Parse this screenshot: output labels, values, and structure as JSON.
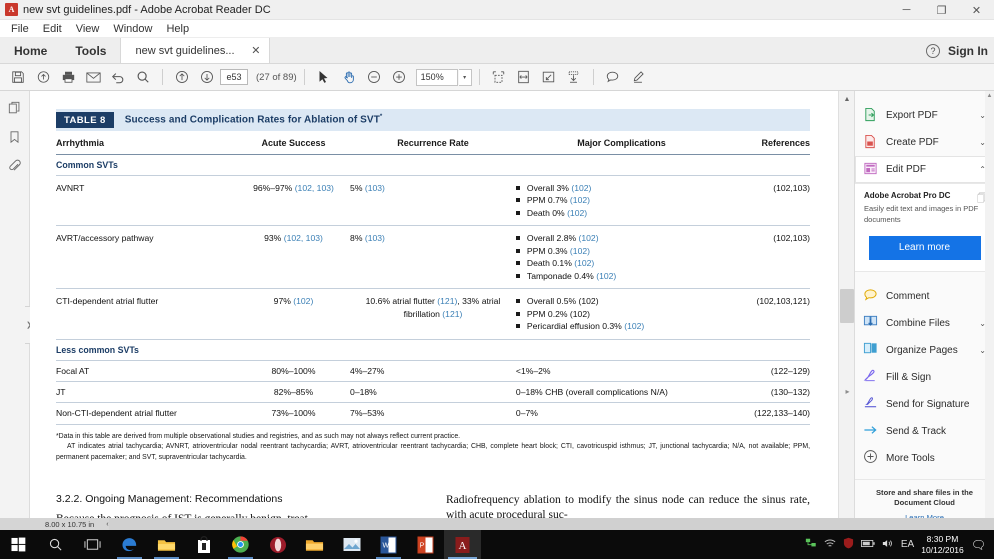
{
  "window": {
    "title": "new svt guidelines.pdf - Adobe Acrobat Reader DC",
    "app_icon": "pdf-icon",
    "minimize": "─",
    "maximize": "❐",
    "close": "✕"
  },
  "menubar": {
    "items": [
      "File",
      "Edit",
      "View",
      "Window",
      "Help"
    ]
  },
  "tabbar": {
    "home": "Home",
    "tools": "Tools",
    "doc_tab": "new svt guidelines...",
    "doc_tab_close": "✕",
    "help_icon": "?",
    "sign_in": "Sign In"
  },
  "toolbar": {
    "page_value": "e53",
    "page_count": "(27 of 89)",
    "zoom_value": "150%",
    "zoom_caret": "▾",
    "icons": [
      "save-icon",
      "upload-cloud-icon",
      "print-icon",
      "email-icon",
      "undo-icon",
      "search-icon",
      "previous-page-icon",
      "next-page-icon",
      "select-tool-icon",
      "hand-tool-icon",
      "zoom-out-icon",
      "zoom-in-icon",
      "fit-page-icon",
      "fit-width-icon",
      "fullscreen-icon",
      "scroll-mode-icon",
      "comment-icon",
      "highlight-icon"
    ]
  },
  "left_rail": {
    "icons": [
      "page-thumbnails-icon",
      "bookmarks-icon",
      "attachments-icon"
    ],
    "handle": "❯"
  },
  "document": {
    "table": {
      "badge": "TABLE 8",
      "title": "Success and Complication Rates for Ablation of SVT",
      "title_sup": "*",
      "columns": [
        "Arrhythmia",
        "Acute Success",
        "Recurrence Rate",
        "Major Complications",
        "References"
      ],
      "groups": [
        {
          "label": "Common SVTs",
          "rows": [
            {
              "arrhythmia": "AVNRT",
              "acute_success": "96%–97%",
              "acute_success_ref": "(102, 103)",
              "recurrence": "5%",
              "recurrence_ref": "(103)",
              "complications": [
                {
                  "text": "Overall 3%",
                  "ref": "(102)"
                },
                {
                  "text": "PPM 0.7%",
                  "ref": "(102)"
                },
                {
                  "text": "Death 0%",
                  "ref": "(102)"
                }
              ],
              "references": "(102,103)"
            },
            {
              "arrhythmia": "AVRT/accessory pathway",
              "acute_success": "93%",
              "acute_success_ref": "(102, 103)",
              "recurrence": "8%",
              "recurrence_ref": "(103)",
              "complications": [
                {
                  "text": "Overall 2.8%",
                  "ref": "(102)"
                },
                {
                  "text": "PPM 0.3%",
                  "ref": "(102)"
                },
                {
                  "text": "Death 0.1%",
                  "ref": "(102)"
                },
                {
                  "text": "Tamponade 0.4%",
                  "ref": "(102)"
                }
              ],
              "references": "(102,103)"
            },
            {
              "arrhythmia": "CTI-dependent atrial flutter",
              "acute_success": "97%",
              "acute_success_ref": "(102)",
              "recurrence": "10.6% atrial flutter",
              "recurrence_ref": "(121)",
              "recurrence_line2": ", 33% atrial",
              "recurrence_line3": "fibrillation",
              "recurrence_ref2": "(121)",
              "complications": [
                {
                  "text": "Overall 0.5% (102)",
                  "ref": ""
                },
                {
                  "text": "PPM 0.2% (102)",
                  "ref": ""
                },
                {
                  "text": "Pericardial effusion 0.3%",
                  "ref": "(102)"
                }
              ],
              "references": "(102,103,121)"
            }
          ]
        },
        {
          "label": "Less common SVTs",
          "rows": [
            {
              "arrhythmia": "Focal AT",
              "acute_success": "80%–100%",
              "acute_success_ref": "",
              "recurrence": "4%–27%",
              "recurrence_ref": "",
              "complications_plain": "<1%–2%",
              "references": "(122–129)"
            },
            {
              "arrhythmia": "JT",
              "acute_success": "82%–85%",
              "acute_success_ref": "",
              "recurrence": "0–18%",
              "recurrence_ref": "",
              "complications_plain": "0–18% CHB (overall complications N/A)",
              "references": "(130–132)"
            },
            {
              "arrhythmia": "Non-CTI-dependent atrial flutter",
              "acute_success": "73%–100%",
              "acute_success_ref": "",
              "recurrence": "7%–53%",
              "recurrence_ref": "",
              "complications_plain": "0–7%",
              "references": "(122,133–140)"
            }
          ]
        }
      ],
      "footnote_1": "*Data in this table are derived from multiple observational studies and registries, and as such may not always reflect current practice.",
      "footnote_2": "AT indicates atrial tachycardia; AVNRT, atrioventricular nodal reentrant tachycardia; AVRT, atrioventricular reentrant tachycardia; CHB, complete heart block; CTI, cavotricuspid isthmus; JT, junctional tachycardia; N/A, not available; PPM, permanent pacemaker; and SVT, supraventricular tachycardia."
    },
    "body": {
      "left_heading": "3.2.2. Ongoing Management: Recommendations",
      "left_paragraph": "Because the prognosis of IST is generally benign, treat-",
      "right_paragraph": "Radiofrequency ablation to modify the sinus node can reduce the sinus rate, with acute procedural suc-"
    }
  },
  "right_panel": {
    "tools": [
      {
        "label": "Export PDF",
        "icon": "export-pdf-icon",
        "chevron": "⌄"
      },
      {
        "label": "Create PDF",
        "icon": "create-pdf-icon",
        "chevron": "⌄"
      },
      {
        "label": "Edit PDF",
        "icon": "edit-pdf-icon",
        "chevron": "⌃"
      }
    ],
    "promo": {
      "title": "Adobe Acrobat Pro DC",
      "description": "Easily edit text and images in PDF documents",
      "button": "Learn more",
      "copy_icon": "copy-icon"
    },
    "tools2": [
      {
        "label": "Comment",
        "icon": "comment-icon",
        "chevron": ""
      },
      {
        "label": "Combine Files",
        "icon": "combine-files-icon",
        "chevron": "⌄"
      },
      {
        "label": "Organize Pages",
        "icon": "organize-pages-icon",
        "chevron": "⌄"
      },
      {
        "label": "Fill & Sign",
        "icon": "fill-sign-icon",
        "chevron": ""
      },
      {
        "label": "Send for Signature",
        "icon": "send-signature-icon",
        "chevron": ""
      },
      {
        "label": "Send & Track",
        "icon": "send-track-icon",
        "chevron": ""
      },
      {
        "label": "More Tools",
        "icon": "more-tools-icon",
        "chevron": ""
      }
    ],
    "cloud_note": {
      "line1": "Store and share files in the Document Cloud",
      "link": "Learn More"
    }
  },
  "status": {
    "page_size": "8.00 x 10.75 in",
    "hscroll_left": "‹"
  },
  "taskbar": {
    "start": "start-icon",
    "items": [
      "search-icon",
      "task-view-icon",
      "edge-icon",
      "file-explorer-icon",
      "store-icon",
      "chrome-icon",
      "opera-icon",
      "folder-icon",
      "photos-icon",
      "word-icon",
      "powerpoint-icon",
      "acrobat-icon"
    ],
    "tray_icons": [
      "network-icon",
      "wifi-icon",
      "shield-icon",
      "battery-icon",
      "volume-icon"
    ],
    "language": "EA",
    "time": "8:30 PM",
    "date": "10/12/2016",
    "notification": "notification-icon"
  },
  "colors": {
    "accent_blue": "#1473e6",
    "table_header_bg": "#dce8f4",
    "table_badge_bg": "#1c3d66",
    "reference_blue": "#3a7fb5"
  }
}
